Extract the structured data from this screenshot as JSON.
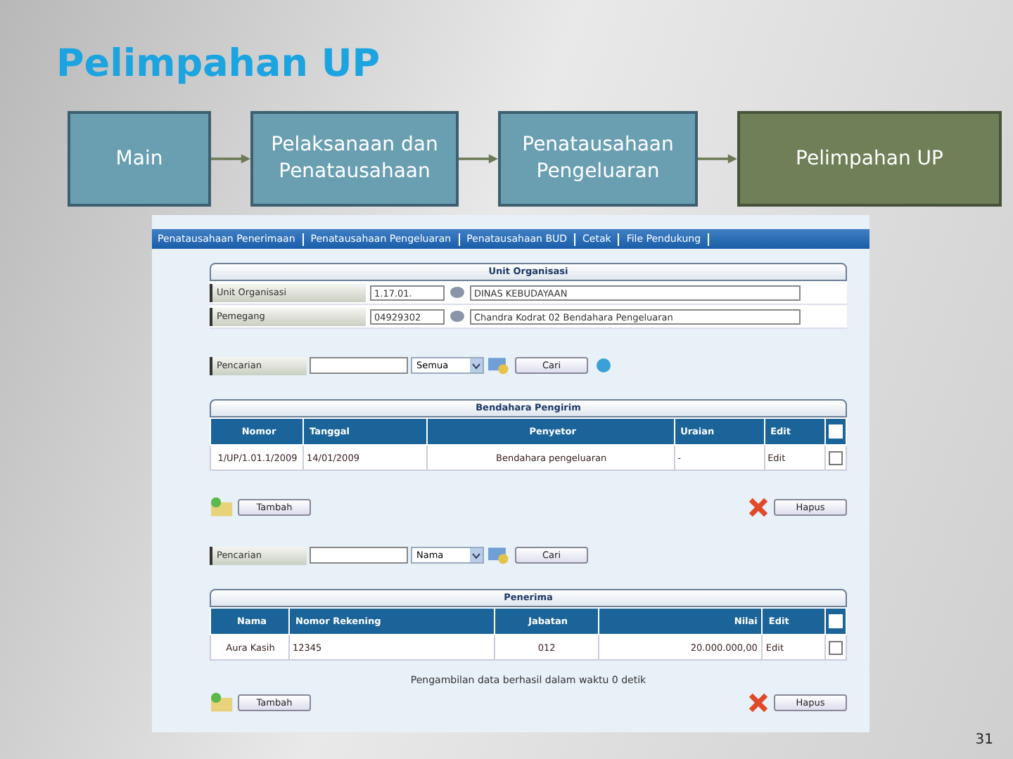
{
  "title": "Pelimpahan UP",
  "flow": [
    {
      "label": "Main",
      "selected": false
    },
    {
      "label": "Pelaksanaan dan Penatausahaan",
      "selected": false
    },
    {
      "label": "Penatausahaan Pengeluaran",
      "selected": false
    },
    {
      "label": "Pelimpahan UP",
      "selected": true
    }
  ],
  "app": {
    "tabs": [
      "Penatausahaan Penerimaan",
      "Penatausahaan Pengeluaran",
      "Penatausahaan BUD",
      "Cetak",
      "File Pendukung"
    ],
    "unit": {
      "heading": "Unit Organisasi",
      "fields": [
        {
          "label": "Unit Organisasi",
          "code": "1.17.01.",
          "name": "DINAS KEBUDAYAAN"
        },
        {
          "label": "Pemegang",
          "code": "04929302",
          "name": "Chandra Kodrat 02 Bendahara Pengeluaran"
        }
      ]
    },
    "search1": {
      "label": "Pencarian",
      "option": "Semua",
      "button": "Cari"
    },
    "table1": {
      "heading": "Bendahara Pengirim",
      "columns": [
        "Nomor",
        "Tanggal",
        "Penyetor",
        "Uraian",
        "Edit"
      ],
      "header_checked": false,
      "rows": [
        {
          "cells": [
            "1/UP/1.01.1/2009",
            "14/01/2009",
            "Bendahara pengeluaran",
            "-",
            "Edit"
          ],
          "checked": false
        }
      ]
    },
    "buttons1": {
      "add": "Tambah",
      "delete": "Hapus"
    },
    "search2": {
      "label": "Pencarian",
      "option": "Nama",
      "button": "Cari"
    },
    "table2": {
      "heading": "Penerima",
      "columns": [
        "Nama",
        "Nomor Rekening",
        "Jabatan",
        "Nilai",
        "Edit"
      ],
      "header_checked": false,
      "rows": [
        {
          "cells": [
            "Aura Kasih",
            "12345",
            "012",
            "20.000.000,00",
            "Edit"
          ],
          "checked": false
        }
      ]
    },
    "footer": "Pengambilan data berhasil dalam waktu 0 detik",
    "buttons2": {
      "add": "Tambah",
      "delete": "Hapus"
    }
  },
  "page_number": "31"
}
